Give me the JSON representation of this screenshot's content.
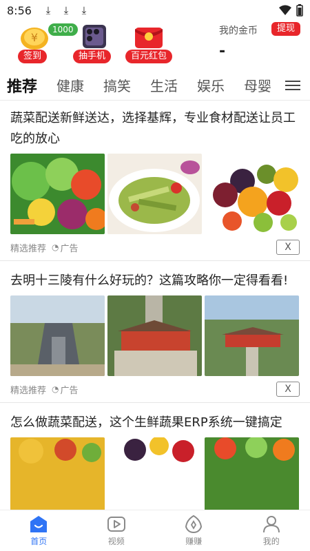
{
  "status_bar": {
    "time": "8:56",
    "download_icons": [
      "download-icon",
      "download-icon",
      "download-icon"
    ],
    "wifi_icon": "wifi-icon",
    "battery_icon": "battery-icon"
  },
  "header": {
    "rewards": [
      {
        "name": "checkin",
        "label": "签到",
        "tag": "1000元",
        "icon": "coin-bag-icon"
      },
      {
        "name": "phone",
        "label": "抽手机",
        "icon": "phone-icon"
      },
      {
        "name": "redpacket",
        "label": "百元红包",
        "icon": "red-packet-icon"
      }
    ],
    "gold_label": "我的金币",
    "withdraw_label": "提现",
    "gold_value": "-"
  },
  "tabs": {
    "items": [
      "推荐",
      "健康",
      "搞笑",
      "生活",
      "娱乐",
      "母婴"
    ],
    "active_index": 0,
    "menu_icon": "menu-icon"
  },
  "feed": [
    {
      "title": "蔬菜配送新鲜送达，选择基辉，专业食材配送让员工吃的放心",
      "source": "精选推荐",
      "ad_label": "广告",
      "close_label": "X"
    },
    {
      "title": "去明十三陵有什么好玩的？这篇攻略你一定得看看!",
      "source": "精选推荐",
      "ad_label": "广告",
      "close_label": "X"
    },
    {
      "title": "怎么做蔬菜配送，这个生鲜蔬果ERP系统一键搞定",
      "source": "",
      "ad_label": "",
      "close_label": ""
    }
  ],
  "bottom_nav": [
    {
      "label": "首页",
      "icon": "home-icon",
      "active": true
    },
    {
      "label": "视频",
      "icon": "video-icon",
      "active": false
    },
    {
      "label": "赚赚",
      "icon": "earn-icon",
      "active": false
    },
    {
      "label": "我的",
      "icon": "profile-icon",
      "active": false
    }
  ],
  "colors": {
    "accent": "#2f74f5",
    "brand_red": "#e8262b",
    "tag_green": "#3fae4a"
  }
}
